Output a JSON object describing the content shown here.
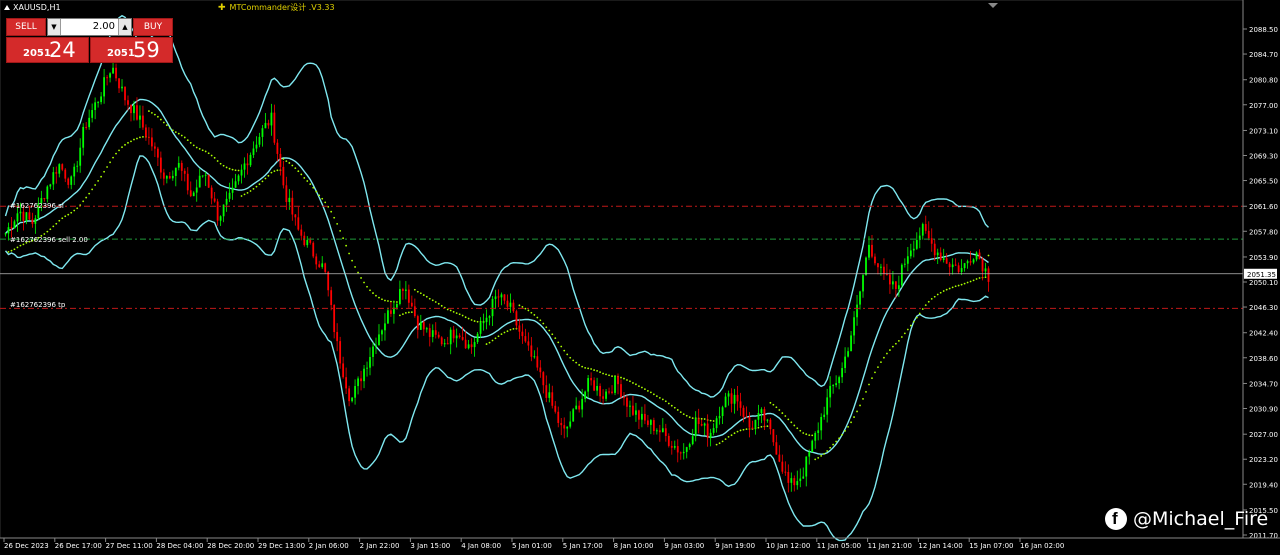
{
  "window": {
    "symbol_title": "XAUUSD,H1"
  },
  "ea": {
    "label": "MTCommander设计 .V3.33"
  },
  "panel": {
    "sell_label": "SELL",
    "buy_label": "BUY",
    "lot_value": "2.00",
    "bid_small": "2051",
    "bid_big": "24",
    "ask_small": "2051",
    "ask_big": "59",
    "color": "#d42a2a"
  },
  "order_lines": {
    "sl_label": "#162762396 sl",
    "open_label": "#162762396 sell 2.00",
    "tp_label": "#162762396 tp"
  },
  "watermark": {
    "text": "@Michael_Fire",
    "icon": "facebook-icon"
  },
  "chart_data": {
    "type": "candlestick",
    "symbol": "XAUUSD",
    "timeframe": "H1",
    "y_ticks": [
      "2088.50",
      "2084.70",
      "2080.80",
      "2077.00",
      "2073.10",
      "2069.30",
      "2065.50",
      "2061.60",
      "2057.80",
      "2053.90",
      "2050.10",
      "2046.30",
      "2042.40",
      "2038.60",
      "2034.70",
      "2030.90",
      "2027.00",
      "2023.20",
      "2019.40",
      "2015.50",
      "2011.70"
    ],
    "x_ticks": [
      "26 Dec 2023",
      "26 Dec 17:00",
      "27 Dec 11:00",
      "28 Dec 04:00",
      "28 Dec 20:00",
      "29 Dec 13:00",
      "2 Jan 06:00",
      "2 Jan 22:00",
      "3 Jan 15:00",
      "4 Jan 08:00",
      "5 Jan 01:00",
      "5 Jan 17:00",
      "8 Jan 10:00",
      "9 Jan 03:00",
      "9 Jan 19:00",
      "10 Jan 12:00",
      "11 Jan 05:00",
      "11 Jan 21:00",
      "12 Jan 14:00",
      "15 Jan 07:00",
      "16 Jan 02:00"
    ],
    "ylim": [
      2011.7,
      2088.5
    ],
    "current_price": "2051.35",
    "levels": {
      "stop_loss": 2061.6,
      "open": 2056.6,
      "current": 2051.35,
      "take_profit": 2046.1
    },
    "colors": {
      "bull": "#00ff00",
      "bear": "#ff0000",
      "bands": "#7fe8f0",
      "sar": "#aaff00",
      "sl_tp": "#c01818",
      "open": "#1f9a3a"
    },
    "close_path": [
      2057.5,
      2061,
      2059,
      2064,
      2068,
      2065,
      2074,
      2078,
      2083,
      2078,
      2075,
      2071,
      2066,
      2068,
      2063,
      2067,
      2060,
      2063,
      2068,
      2072,
      2075,
      2064,
      2058,
      2055,
      2052,
      2040,
      2032,
      2037,
      2042,
      2046,
      2050,
      2044,
      2042,
      2041,
      2043,
      2040,
      2044,
      2048,
      2046,
      2041,
      2037,
      2032,
      2027,
      2031,
      2035,
      2033,
      2035,
      2031,
      2029,
      2028,
      2026,
      2024,
      2029,
      2027,
      2032,
      2033,
      2028,
      2030,
      2025,
      2019,
      2021,
      2027,
      2033,
      2037,
      2045,
      2056,
      2051,
      2049,
      2055,
      2058,
      2055,
      2053,
      2052,
      2055,
      2051
    ]
  }
}
